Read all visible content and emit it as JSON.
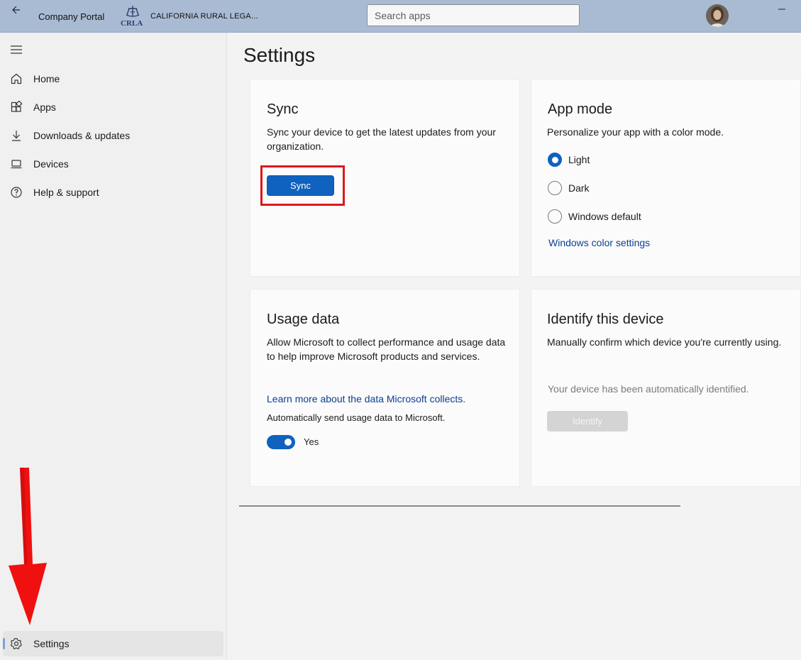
{
  "titlebar": {
    "app_title": "Company Portal",
    "org_logo_text": "CRLA",
    "org_name": "CALIFORNIA RURAL LEGA...",
    "search_placeholder": "Search apps"
  },
  "sidebar": {
    "items": [
      {
        "label": "Home",
        "icon": "home-icon"
      },
      {
        "label": "Apps",
        "icon": "apps-icon"
      },
      {
        "label": "Downloads & updates",
        "icon": "download-icon"
      },
      {
        "label": "Devices",
        "icon": "laptop-icon"
      },
      {
        "label": "Help & support",
        "icon": "help-icon"
      }
    ],
    "settings": {
      "label": "Settings",
      "icon": "gear-icon",
      "active": true
    }
  },
  "main": {
    "title": "Settings",
    "sync_card": {
      "title": "Sync",
      "description": "Sync your device to get the latest updates from your organization.",
      "button_label": "Sync"
    },
    "app_mode_card": {
      "title": "App mode",
      "description": "Personalize your app with a color mode.",
      "options": [
        {
          "label": "Light",
          "checked": true
        },
        {
          "label": "Dark",
          "checked": false
        },
        {
          "label": "Windows default",
          "checked": false
        }
      ],
      "link": "Windows color settings"
    },
    "usage_card": {
      "title": "Usage data",
      "description": "Allow Microsoft to collect performance and usage data to help improve Microsoft products and services.",
      "link": "Learn more about the data Microsoft collects.",
      "auto_send_label": "Automatically send usage data to Microsoft.",
      "toggle_on": true,
      "toggle_label": "Yes"
    },
    "identify_card": {
      "title": "Identify this device",
      "description": "Manually confirm which device you're currently using.",
      "status": "Your device has been automatically identified.",
      "button_label": "Identify"
    }
  },
  "colors": {
    "titlebar": "#a9bbd3",
    "accent": "#0f62be",
    "annotation": "#e01818"
  }
}
